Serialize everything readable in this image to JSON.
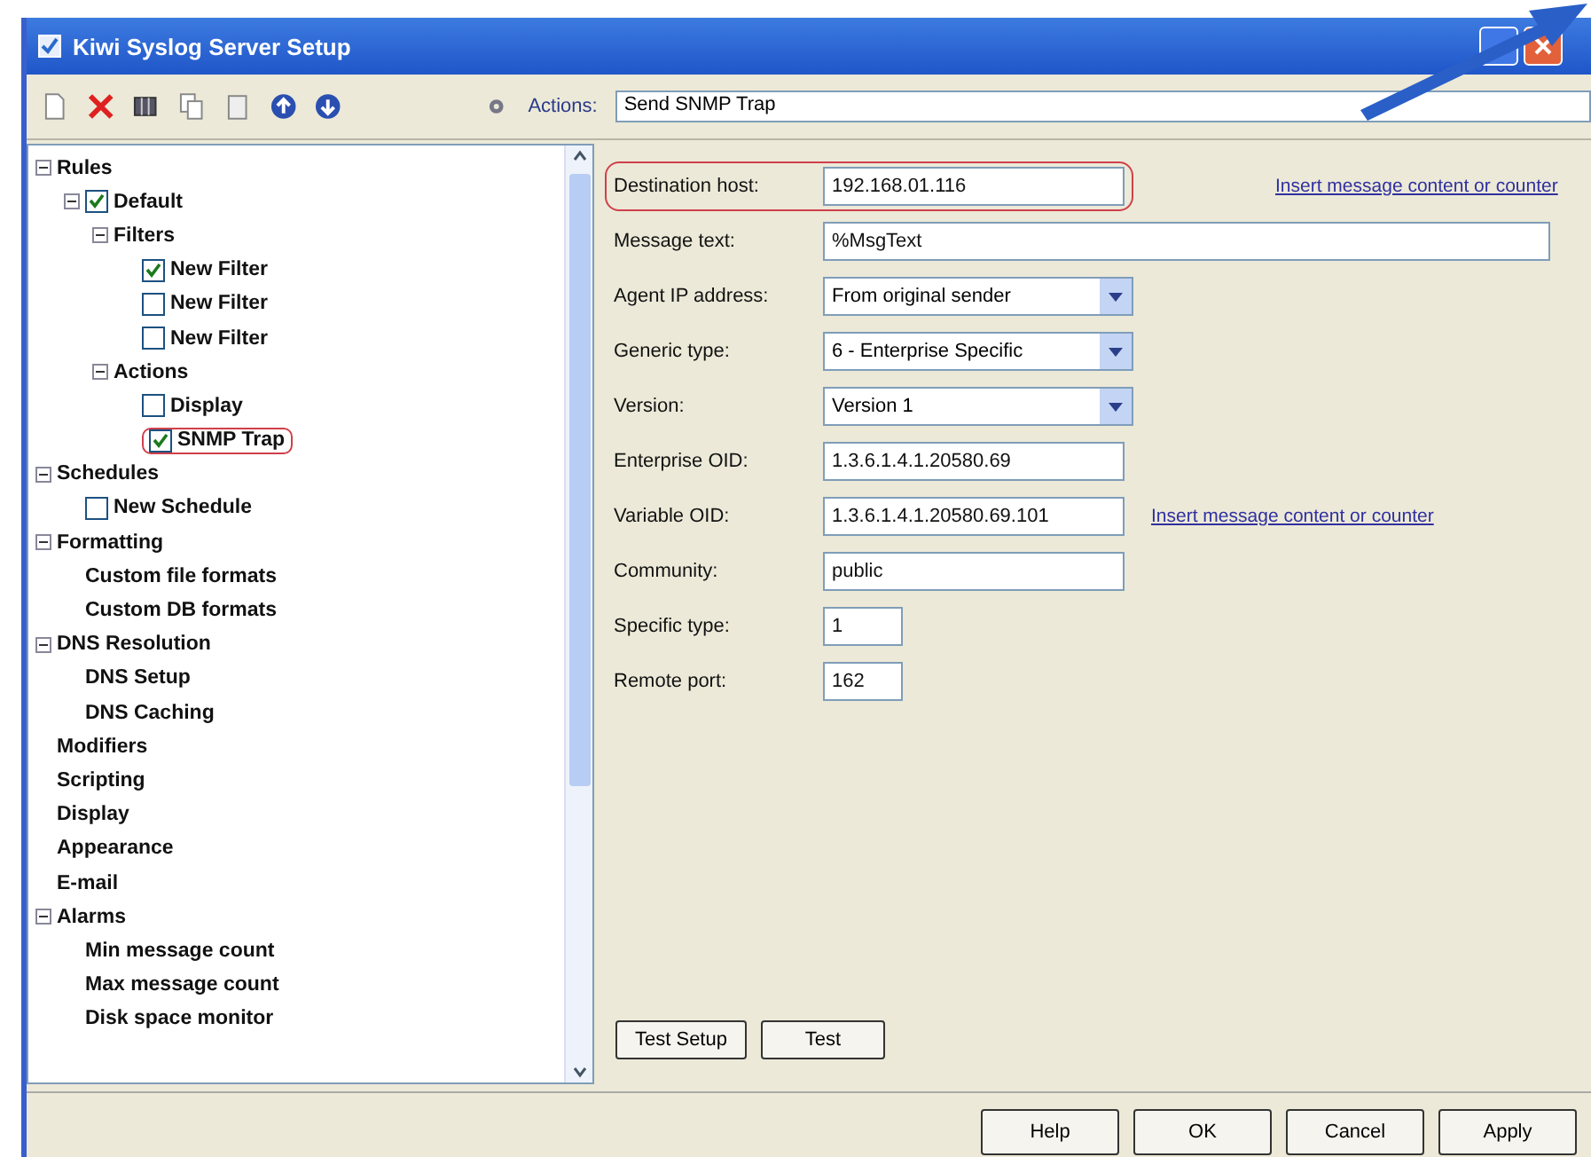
{
  "window": {
    "title": "Kiwi Syslog Server Setup"
  },
  "toolbar": {
    "actions_label": "Actions:",
    "actions_value": "Send SNMP Trap"
  },
  "tree": [
    {
      "label": "Rules",
      "expanded": true,
      "children": [
        {
          "label": "Default",
          "kind": "checkbox",
          "checked": true,
          "expanded": true,
          "children": [
            {
              "label": "Filters",
              "expanded": true,
              "children": [
                {
                  "label": "New Filter",
                  "kind": "checkbox",
                  "checked": true
                },
                {
                  "label": "New Filter",
                  "kind": "checkbox",
                  "checked": false
                },
                {
                  "label": "New Filter",
                  "kind": "checkbox",
                  "checked": false
                }
              ]
            },
            {
              "label": "Actions",
              "expanded": true,
              "children": [
                {
                  "label": "Display",
                  "kind": "checkbox",
                  "checked": false,
                  "highlighted": false
                },
                {
                  "label": "SNMP Trap",
                  "kind": "checkbox",
                  "checked": true,
                  "highlighted": true
                }
              ]
            }
          ]
        }
      ]
    },
    {
      "label": "Schedules",
      "expanded": true,
      "children": [
        {
          "label": "New Schedule",
          "kind": "checkbox",
          "checked": false
        }
      ]
    },
    {
      "label": "Formatting",
      "expanded": true,
      "children": [
        {
          "label": "Custom file formats"
        },
        {
          "label": "Custom DB formats"
        }
      ]
    },
    {
      "label": "DNS Resolution",
      "expanded": true,
      "children": [
        {
          "label": "DNS Setup"
        },
        {
          "label": "DNS Caching"
        }
      ]
    },
    {
      "label": "Modifiers"
    },
    {
      "label": "Scripting"
    },
    {
      "label": "Display"
    },
    {
      "label": "Appearance"
    },
    {
      "label": "E-mail"
    },
    {
      "label": "Alarms",
      "expanded": true,
      "children": [
        {
          "label": "Min message count"
        },
        {
          "label": "Max message count"
        },
        {
          "label": "Disk space monitor"
        }
      ]
    }
  ],
  "form": {
    "fields": [
      {
        "label": "Destination host:",
        "kind": "text",
        "value": "192.168.01.116",
        "highlighted": true,
        "link": "Insert message content or counter"
      },
      {
        "label": "Message text:",
        "kind": "wide",
        "value": "%MsgText",
        "highlighted": false
      },
      {
        "label": "Agent IP address:",
        "kind": "dropdown",
        "value": "From original sender",
        "highlighted": false
      },
      {
        "label": "Generic type:",
        "kind": "dropdown",
        "value": "6 - Enterprise Specific",
        "highlighted": false
      },
      {
        "label": "Version:",
        "kind": "dropdown",
        "value": "Version 1",
        "highlighted": false
      },
      {
        "label": "Enterprise OID:",
        "kind": "text",
        "value": "1.3.6.1.4.1.20580.69",
        "highlighted": false
      },
      {
        "label": "Variable OID:",
        "kind": "text",
        "value": "1.3.6.1.4.1.20580.69.101",
        "highlighted": false,
        "link": "Insert message content or counter"
      },
      {
        "label": "Community:",
        "kind": "text",
        "value": "public",
        "highlighted": false
      },
      {
        "label": "Specific type:",
        "kind": "short",
        "value": "1",
        "highlighted": false
      },
      {
        "label": "Remote port:",
        "kind": "short",
        "value": "162",
        "highlighted": false
      }
    ],
    "buttons": [
      "Test Setup",
      "Test"
    ]
  },
  "footer_buttons": [
    "Help",
    "OK",
    "Cancel",
    "Apply"
  ]
}
